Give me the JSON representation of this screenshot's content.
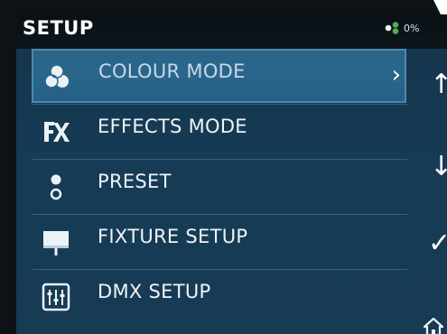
{
  "header": {
    "title": "SETUP",
    "status_text": "0%",
    "status_icon": "network-dots-icon",
    "status_color": "#4caf50"
  },
  "menu": {
    "items": [
      {
        "label": "COLOUR MODE",
        "icon": "colour-mode-icon",
        "selected": true
      },
      {
        "label": "EFFECTS MODE",
        "icon": "effects-fx-icon",
        "selected": false
      },
      {
        "label": "PRESET",
        "icon": "preset-icon",
        "selected": false
      },
      {
        "label": "FIXTURE SETUP",
        "icon": "fixture-icon",
        "selected": false
      },
      {
        "label": "DMX SETUP",
        "icon": "dmx-sliders-icon",
        "selected": false
      }
    ],
    "chevron": "›"
  },
  "side_buttons": {
    "up": "↑",
    "down": "↓",
    "confirm": "✓",
    "home": "home-icon"
  },
  "colors": {
    "background": "#163b55",
    "selected_row": "#2a668c",
    "header": "#0a1015"
  }
}
